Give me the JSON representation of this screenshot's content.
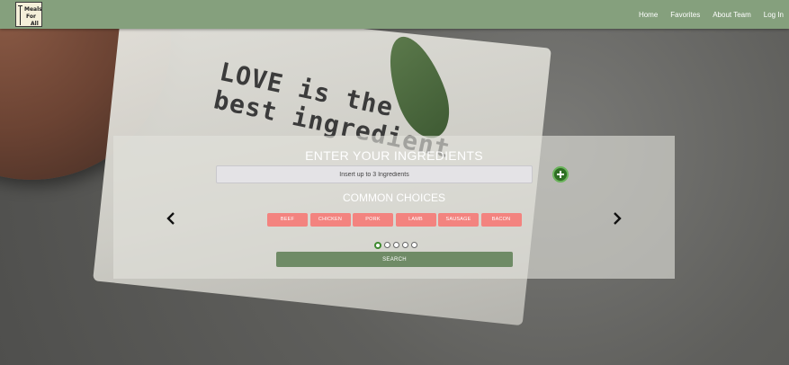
{
  "logo": {
    "line1": "Meals",
    "line2": "For",
    "line3": "All"
  },
  "navbar": {
    "links": [
      "Home",
      "Favorites",
      "About Team",
      "Log In"
    ]
  },
  "background": {
    "print_line1": "LOVE is the",
    "print_line2": "best ingredient"
  },
  "search": {
    "title": "ENTER YOUR INGREDIENTS",
    "placeholder": "Insert up to 3 Ingredients",
    "common_title": "COMMON CHOICES",
    "chips": [
      "BEEF",
      "CHICKEN",
      "PORK",
      "LAMB",
      "SAUSAGE",
      "BACON"
    ],
    "carousel_pages": 5,
    "active_page": 1,
    "search_label": "SEARCH"
  },
  "colors": {
    "navbar": "#85a07d",
    "chip": "#f3837f",
    "search_button": "#6f8b66",
    "add_button": "#2f6e24"
  },
  "icons": {
    "add": "plus-circle-icon",
    "prev": "chevron-left-icon",
    "next": "chevron-right-icon"
  }
}
